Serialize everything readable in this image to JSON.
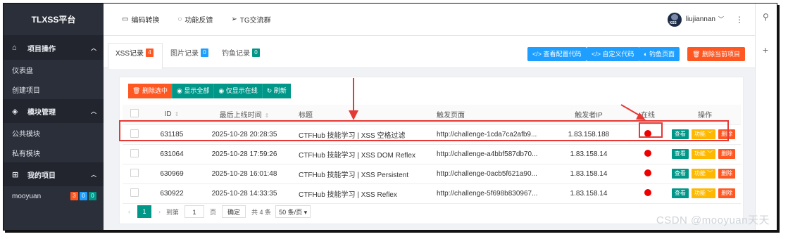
{
  "sidebar": {
    "brand": "TLXSS平台",
    "sections": [
      {
        "label": "项目操作",
        "items": [
          "仪表盘",
          "创建项目"
        ]
      },
      {
        "label": "模块管理",
        "items": [
          "公共模块",
          "私有模块"
        ]
      },
      {
        "label": "我的项目",
        "items": [
          "mooyuan"
        ]
      }
    ],
    "project_badges": [
      "3",
      "0",
      "0"
    ]
  },
  "header": {
    "links": [
      "编码转换",
      "功能反馈",
      "TG交流群"
    ],
    "avatar_text": "XSS",
    "username": "liujiannan"
  },
  "tabs": [
    {
      "label": "XSS记录",
      "count": "4"
    },
    {
      "label": "图片记录",
      "count": "0"
    },
    {
      "label": "钓鱼记录",
      "count": "0"
    }
  ],
  "top_buttons": [
    "</> 查看配置代码",
    "</> 自定义代码",
    "钓鱼页面",
    "删除当前项目"
  ],
  "toolbar": [
    "删除选中",
    "显示全部",
    "仅显示在线",
    "刷新"
  ],
  "table": {
    "headers": [
      "ID",
      "最后上线时间",
      "标题",
      "触发页面",
      "触发者IP",
      "在线",
      "操作"
    ],
    "rows": [
      [
        "631185",
        "2025-10-28 20:28:35",
        "CTFHub 技能学习 | XSS 空格过滤",
        "http://challenge-1cda7ca2afb9...",
        "1.83.158.188"
      ],
      [
        "631064",
        "2025-10-28 17:59:26",
        "CTFHub 技能学习 | XSS DOM Reflex",
        "http://challenge-a4bbf587db70...",
        "1.83.158.14"
      ],
      [
        "630969",
        "2025-10-28 16:01:48",
        "CTFHub 技能学习 | XSS Persistent",
        "http://challenge-0acb5f621a90...",
        "1.83.158.14"
      ],
      [
        "630922",
        "2025-10-28 14:33:35",
        "CTFHub 技能学习 | XSS Reflex",
        "http://challenge-5f698b830967...",
        "1.83.158.14"
      ]
    ],
    "actions": {
      "view": "查看",
      "func": "功能",
      "delete": "删除"
    }
  },
  "pager": {
    "page": "1",
    "goto": "到第",
    "input": "1",
    "page_unit": "页",
    "confirm": "确定",
    "total": "共 4 条",
    "per_page": "50 条/页"
  },
  "watermark": "CSDN @mooyuan天天",
  "colors": {
    "sidebar": "#2b2f3a",
    "teal": "#009688",
    "blue": "#1e9fff",
    "orange": "#ff5722",
    "yellow": "#ffb800",
    "annotation": "#e53935"
  }
}
